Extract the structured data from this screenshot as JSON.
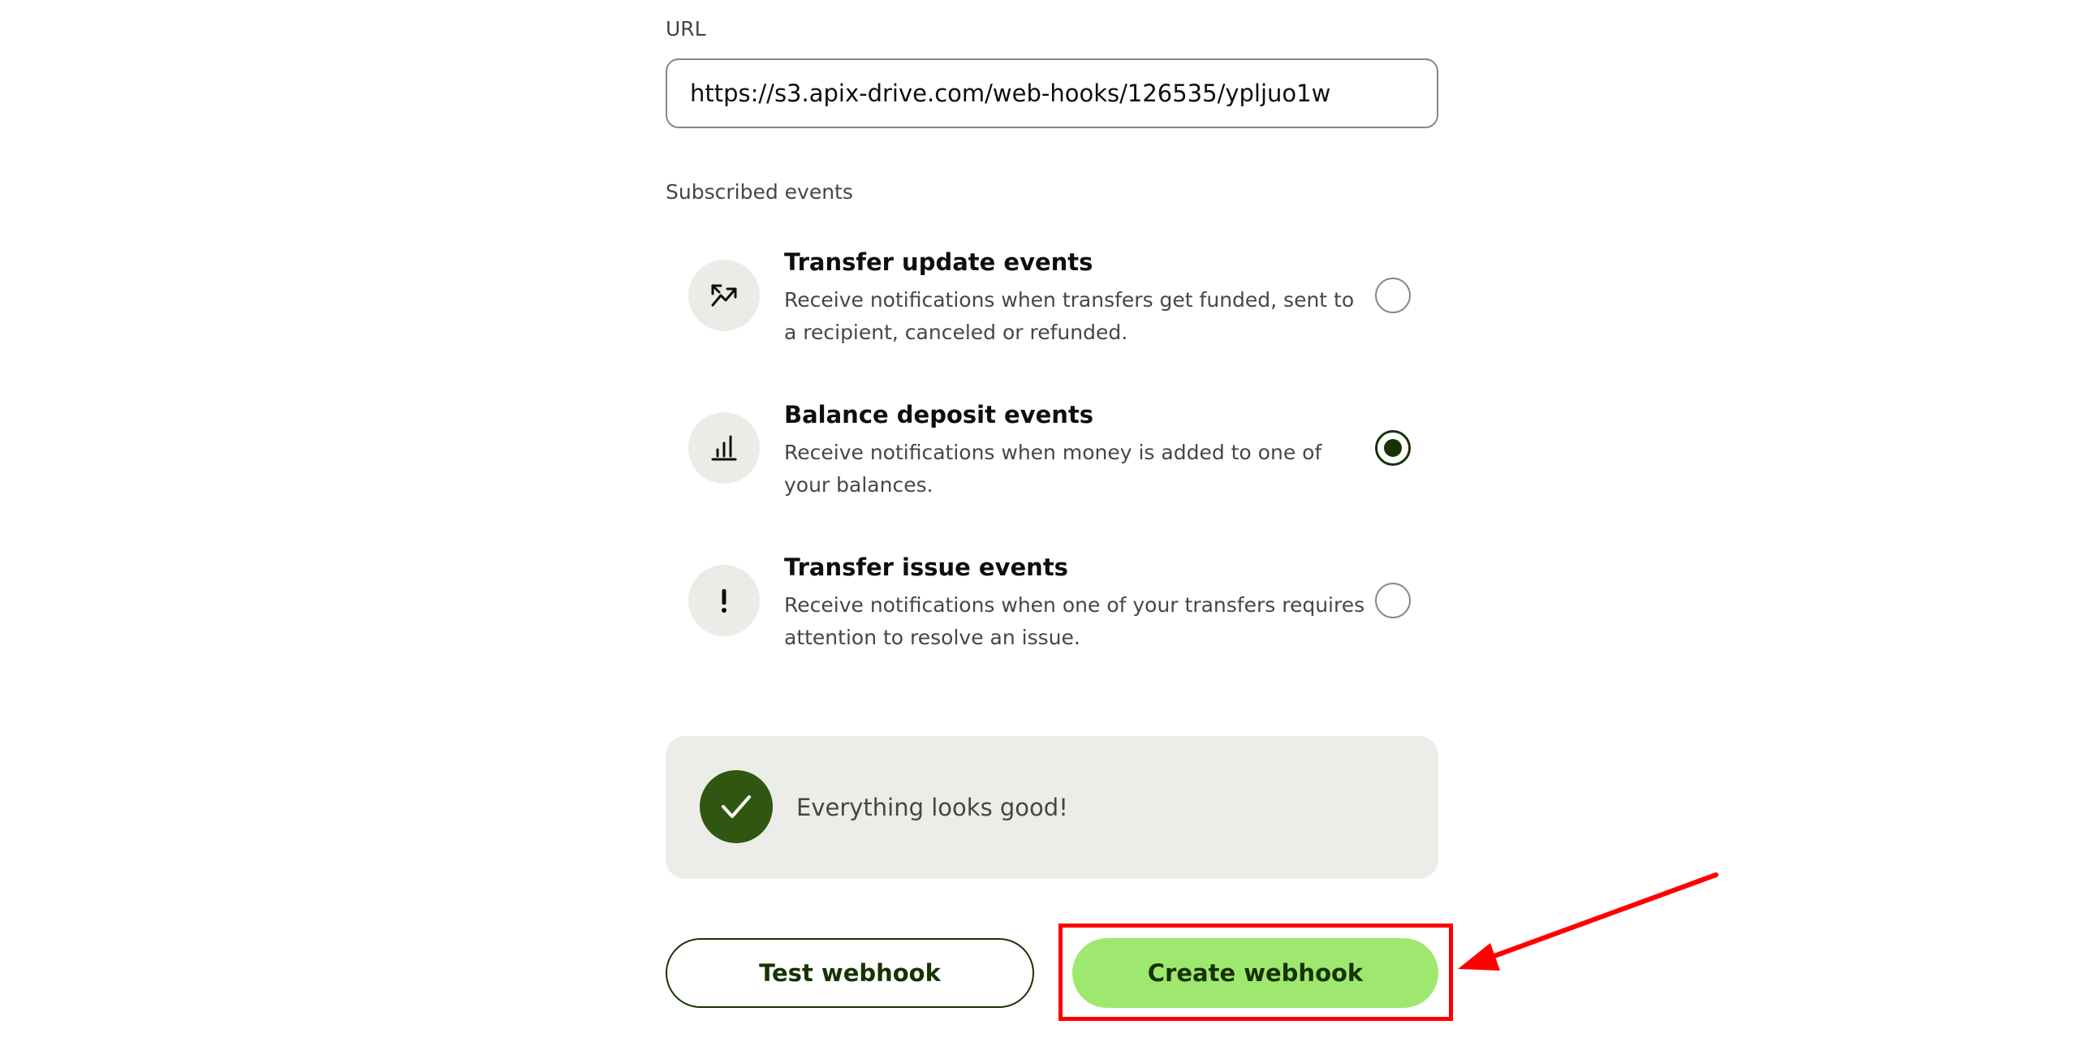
{
  "url_field": {
    "label": "URL",
    "value": "https://s3.apix-drive.com/web-hooks/126535/ypljuo1w"
  },
  "subscribed_events": {
    "label": "Subscribed events",
    "events": [
      {
        "title": "Transfer update events",
        "description": "Receive notifications when transfers get funded, sent to a recipient, canceled or refunded.",
        "icon": "trending-up-arrow-icon",
        "selected": false
      },
      {
        "title": "Balance deposit events",
        "description": "Receive notifications when money is added to one of your balances.",
        "icon": "bar-chart-icon",
        "selected": true
      },
      {
        "title": "Transfer issue events",
        "description": "Receive notifications when one of your transfers requires attention to resolve an issue.",
        "icon": "exclamation-icon",
        "selected": false
      }
    ]
  },
  "status": {
    "message": "Everything looks good!",
    "icon": "checkmark-icon"
  },
  "buttons": {
    "test_label": "Test webhook",
    "create_label": "Create webhook"
  },
  "colors": {
    "accent_green": "#9fe870",
    "dark_green": "#163300",
    "status_check_bg": "#2f5711",
    "annotation_red": "#ff0000"
  }
}
